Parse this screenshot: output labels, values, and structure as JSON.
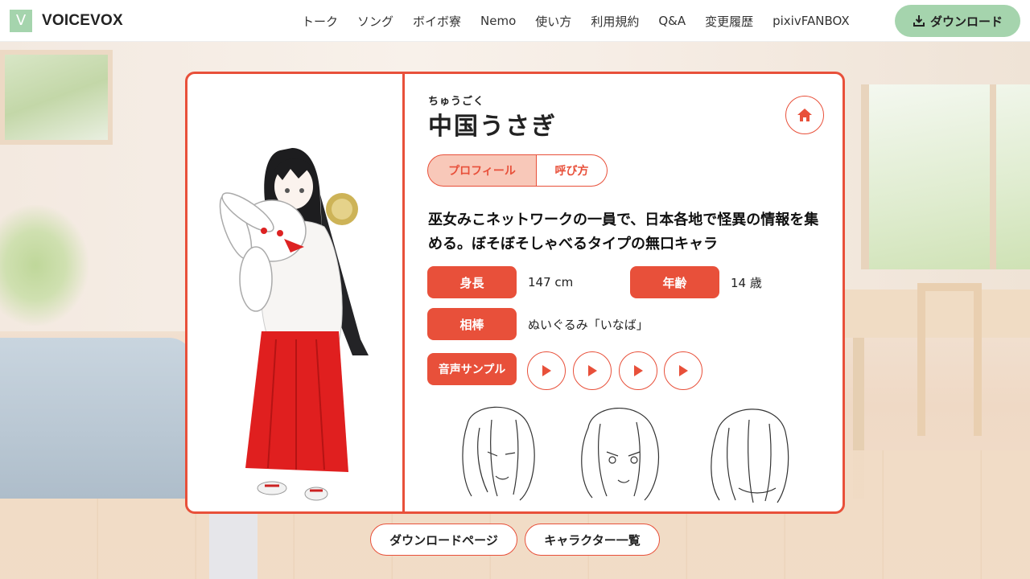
{
  "header": {
    "logo_letter": "V",
    "logo_text": "VOICEVOX",
    "nav": [
      "トーク",
      "ソング",
      "ボイボ寮",
      "Nemo",
      "使い方",
      "利用規約",
      "Q&A",
      "変更履歴",
      "pixivFANBOX"
    ],
    "download_label": "ダウンロード"
  },
  "character": {
    "ruby": "ちゅうごく",
    "name": "中国うさぎ",
    "tabs": {
      "profile": "プロフィール",
      "call": "呼び方"
    },
    "description": "巫女みこネットワークの一員で、日本各地で怪異の情報を集める。ぼそぼそしゃべるタイプの無口キャラ",
    "height_label": "身長",
    "height_value": "147 cm",
    "age_label": "年齢",
    "age_value": "14 歳",
    "partner_label": "相棒",
    "partner_value": "ぬいぐるみ「いなば」",
    "sample_label": "音声サンプル"
  },
  "bottom": {
    "download_page": "ダウンロードページ",
    "character_list": "キャラクター一覧"
  },
  "colors": {
    "accent": "#e8503a",
    "accent_light": "#f8c8b9",
    "brand_green": "#a5d4ad"
  },
  "icons": [
    "download-icon",
    "home-icon",
    "play-icon"
  ]
}
